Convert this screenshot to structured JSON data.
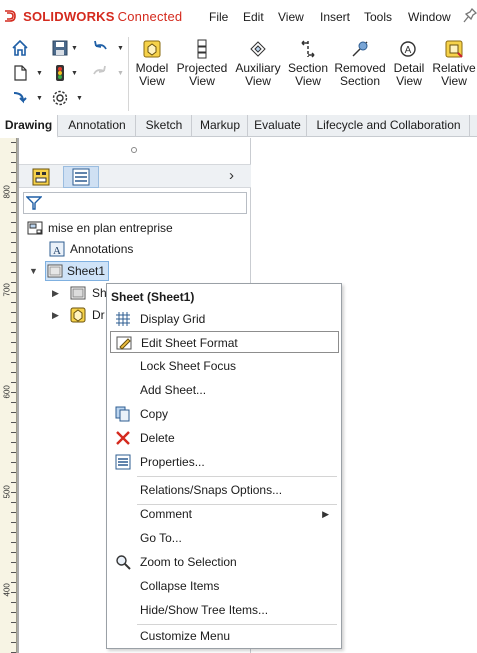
{
  "app": {
    "logo_mark": "3DS",
    "brand": "SOLIDWORKS",
    "brand_suffix": "Connected"
  },
  "menubar": {
    "items": [
      "File",
      "Edit",
      "View",
      "Insert",
      "Tools",
      "Window"
    ]
  },
  "ribbon": {
    "buttons": [
      {
        "label": "Model\nView",
        "icon": "model-view-icon"
      },
      {
        "label": "Projected\nView",
        "icon": "projected-view-icon"
      },
      {
        "label": "Auxiliary\nView",
        "icon": "auxiliary-view-icon"
      },
      {
        "label": "Section\nView",
        "icon": "section-view-icon"
      },
      {
        "label": "Removed\nSection",
        "icon": "removed-section-icon"
      },
      {
        "label": "Detail\nView",
        "icon": "detail-view-icon"
      },
      {
        "label": "Relative\nView",
        "icon": "relative-view-icon"
      }
    ]
  },
  "tabs": [
    "Drawing",
    "Annotation",
    "Sketch",
    "Markup",
    "Evaluate",
    "Lifecycle and Collaboration"
  ],
  "active_tab": "Drawing",
  "ruler": {
    "labels": [
      "800",
      "700",
      "600",
      "500",
      "400"
    ]
  },
  "tree": {
    "root": "mise en plan entreprise",
    "annotations": "Annotations",
    "sheet": "Sheet1",
    "child1": "Sh",
    "child2": "Dr"
  },
  "context_menu": {
    "title": "Sheet (Sheet1)",
    "items": [
      {
        "label": "Display Grid",
        "icon": "grid-icon"
      },
      {
        "label": "Edit Sheet Format",
        "icon": "edit-sheet-format-icon",
        "highlighted": true
      },
      {
        "label": "Lock Sheet Focus"
      },
      {
        "label": "Add Sheet..."
      },
      {
        "label": "Copy",
        "icon": "copy-icon"
      },
      {
        "label": "Delete",
        "icon": "delete-icon"
      },
      {
        "label": "Properties...",
        "icon": "properties-icon"
      },
      {
        "label": "Relations/Snaps Options..."
      },
      {
        "label": "Comment",
        "submenu": true
      },
      {
        "label": "Go To..."
      },
      {
        "label": "Zoom to Selection",
        "icon": "zoom-icon"
      },
      {
        "label": "Collapse Items"
      },
      {
        "label": "Hide/Show Tree Items..."
      },
      {
        "label": "Customize Menu"
      }
    ]
  },
  "colors": {
    "brand_red": "#d42a1e",
    "selection_blue": "#cfe3f8",
    "tab_bar": "#eceff2",
    "ruler_bg": "#f7f4e4"
  }
}
